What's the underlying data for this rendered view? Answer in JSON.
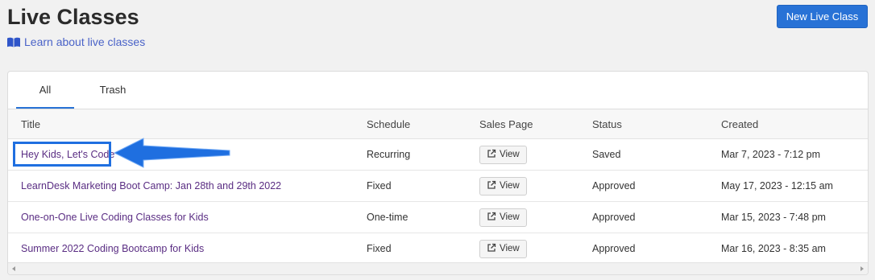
{
  "header": {
    "title": "Live Classes",
    "learn_link": "Learn about live classes",
    "new_button": "New Live Class"
  },
  "tabs": [
    {
      "label": "All",
      "active": true
    },
    {
      "label": "Trash",
      "active": false
    }
  ],
  "table": {
    "columns": [
      "Title",
      "Schedule",
      "Sales Page",
      "Status",
      "Created"
    ],
    "rows": [
      {
        "title": "Hey Kids, Let's Code",
        "schedule": "Recurring",
        "sales_page": "View",
        "status": "Saved",
        "created": "Mar 7, 2023 - 7:12 pm"
      },
      {
        "title": "LearnDesk Marketing Boot Camp: Jan 28th and 29th 2022",
        "schedule": "Fixed",
        "sales_page": "View",
        "status": "Approved",
        "created": "May 17, 2023 - 12:15 am"
      },
      {
        "title": "One-on-One Live Coding Classes for Kids",
        "schedule": "One-time",
        "sales_page": "View",
        "status": "Approved",
        "created": "Mar 15, 2023 - 7:48 pm"
      },
      {
        "title": "Summer 2022 Coding Bootcamp for Kids",
        "schedule": "Fixed",
        "sales_page": "View",
        "status": "Approved",
        "created": "Mar 16, 2023 - 8:35 am"
      }
    ]
  },
  "colors": {
    "accent": "#2872d6",
    "link": "#4a63c8",
    "title_link": "#5a2d83",
    "annotation": "#1f6fe0"
  },
  "icons": {
    "learn": "book-open-icon",
    "view": "external-link-icon"
  }
}
